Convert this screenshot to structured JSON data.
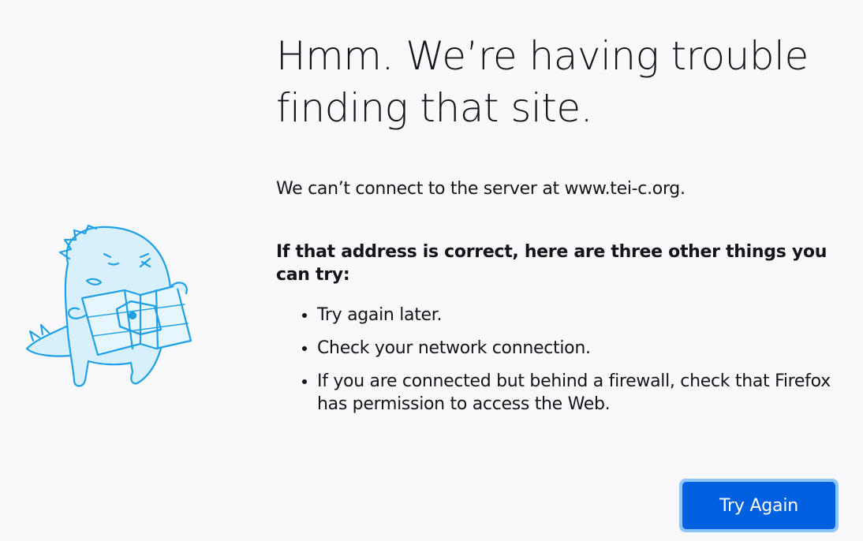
{
  "error": {
    "title": "Hmm. We’re having trouble finding that site.",
    "message": "We can’t connect to the server at www.tei-c.org.",
    "advice_heading": "If that address is correct, here are three other things you can try:",
    "tips": [
      "Try again later.",
      "Check your network connection.",
      "If you are connected but behind a firewall, check that Firefox has permission to access the Web."
    ],
    "button_label": "Try Again"
  },
  "colors": {
    "background": "#f9f9fb",
    "text": "#15141a",
    "button": "#0061e0",
    "button_focus_ring": "#8ec5fb",
    "illustration_stroke": "#1fa0e6",
    "illustration_fill": "#d8f0fc"
  },
  "icons": {
    "illustration": "lost-dinosaur-with-map-illustration"
  }
}
